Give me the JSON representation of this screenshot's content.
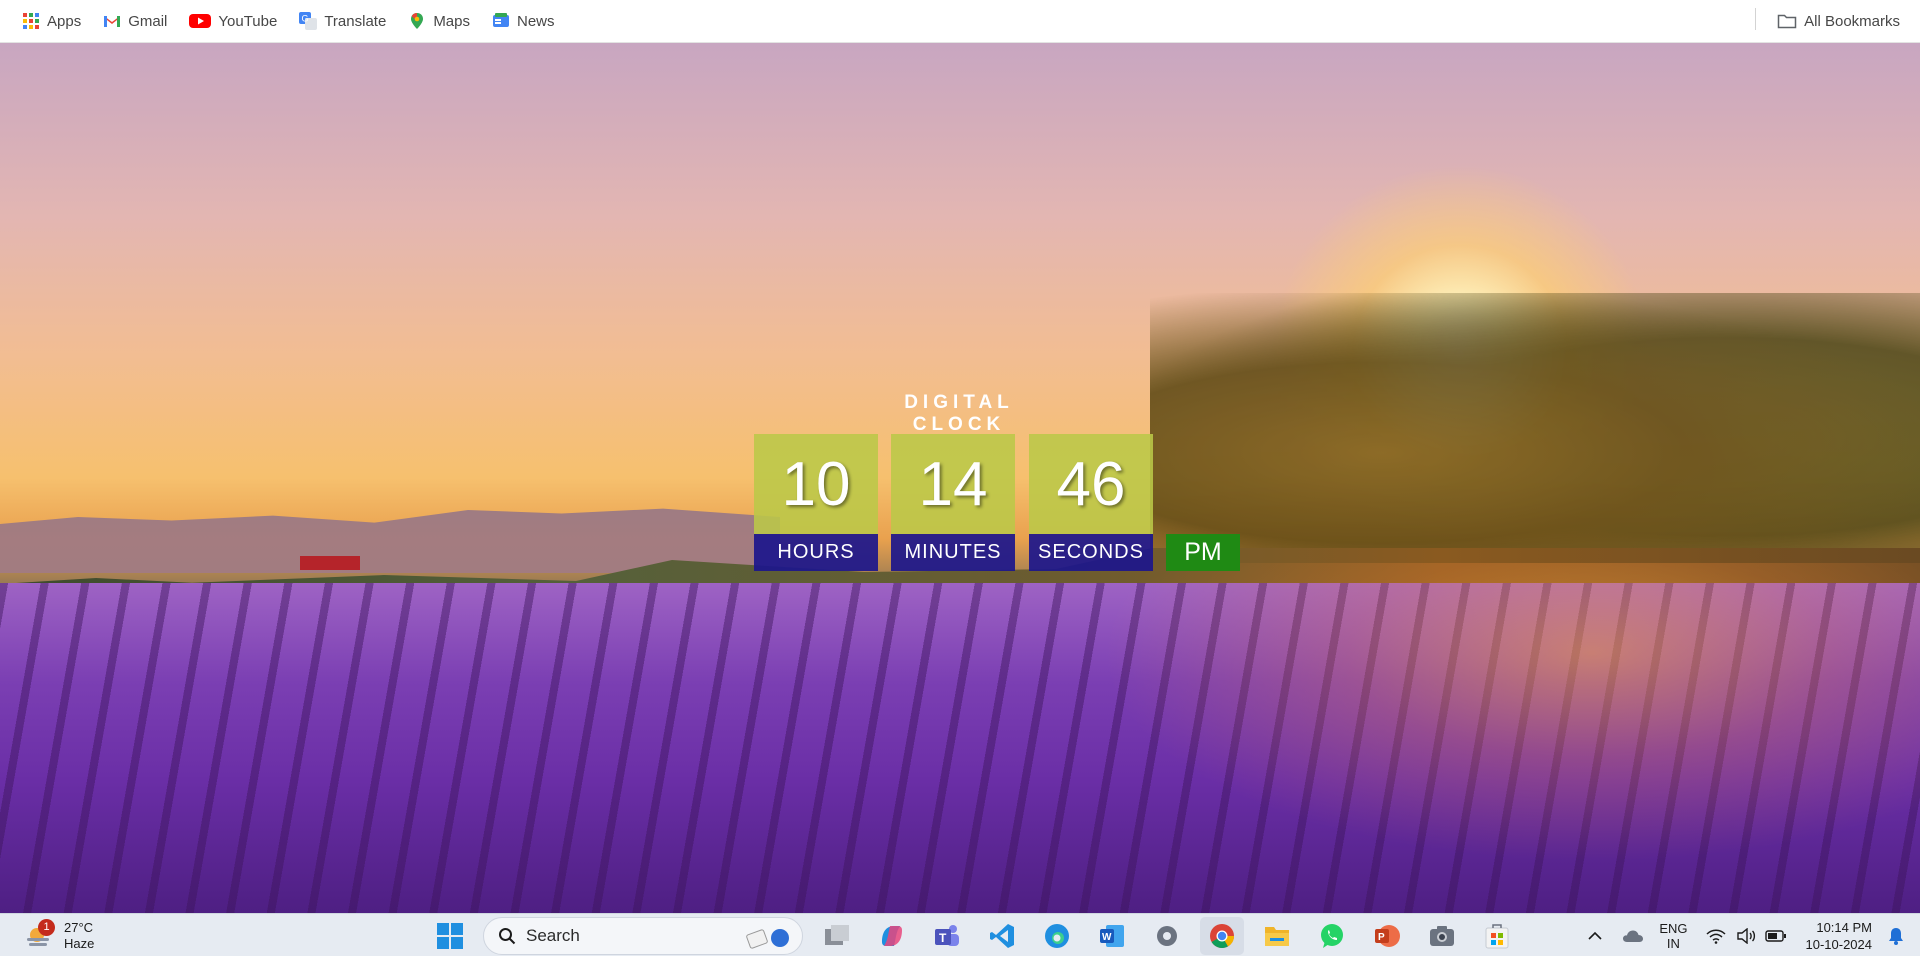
{
  "bookmarks": {
    "items": [
      {
        "label": "Apps",
        "icon": "apps-grid-icon"
      },
      {
        "label": "Gmail",
        "icon": "gmail-icon"
      },
      {
        "label": "YouTube",
        "icon": "youtube-icon"
      },
      {
        "label": "Translate",
        "icon": "translate-icon"
      },
      {
        "label": "Maps",
        "icon": "maps-icon"
      },
      {
        "label": "News",
        "icon": "news-icon"
      }
    ],
    "all_bookmarks_label": "All Bookmarks"
  },
  "clock": {
    "title": "DIGITAL CLOCK",
    "hours": "10",
    "minutes": "14",
    "seconds": "46",
    "hours_label": "HOURS",
    "minutes_label": "MINUTES",
    "seconds_label": "SECONDS",
    "ampm": "PM",
    "colors": {
      "digit_bg": "#bbc848",
      "label_bg": "#1c168c",
      "ampm_bg": "#1f8a14"
    }
  },
  "taskbar": {
    "weather": {
      "temp": "27°C",
      "condition": "Haze",
      "badge": "1"
    },
    "search_placeholder": "Search",
    "apps": [
      "start-icon",
      "search",
      "task-view-icon",
      "copilot-icon",
      "teams-icon",
      "vscode-icon",
      "edge-icon",
      "word-icon",
      "settings-icon",
      "chrome-icon",
      "file-explorer-icon",
      "whatsapp-icon",
      "powerpoint-icon",
      "camera-icon",
      "store-icon"
    ],
    "tray": {
      "lang_line1": "ENG",
      "lang_line2": "IN",
      "time": "10:14 PM",
      "date": "10-10-2024"
    }
  }
}
